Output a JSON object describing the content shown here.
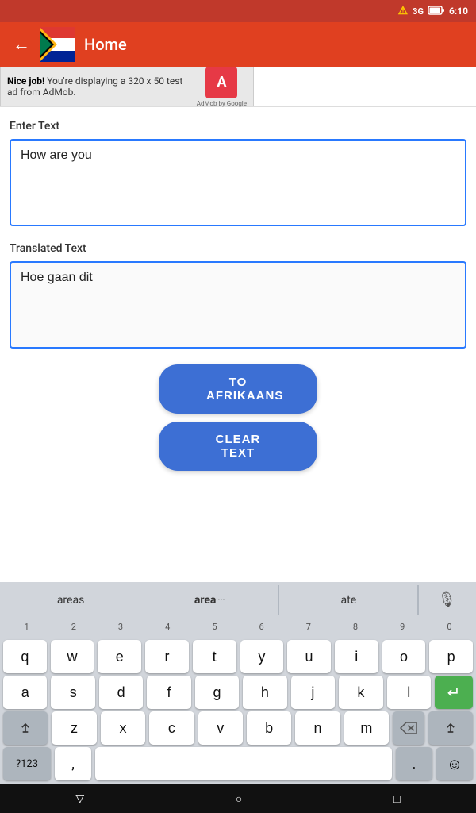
{
  "statusBar": {
    "signal": "3G",
    "battery": "🔋",
    "time": "6:10",
    "alert": "⚠"
  },
  "appBar": {
    "title": "Home",
    "backLabel": "←"
  },
  "ad": {
    "text_bold": "Nice job!",
    "text_regular": " You're displaying a 320 x 50 test ad from AdMob.",
    "logo_letter": "A",
    "sub_text": "AdMob by Google"
  },
  "inputSection": {
    "label": "Enter Text",
    "placeholder": "How are you",
    "value": "How are you"
  },
  "translatedSection": {
    "label": "Translated Text",
    "value": "Hoe gaan dit"
  },
  "buttons": {
    "translate": "TO AFRIKAANS",
    "clear": "CLEAR TEXT"
  },
  "keyboard": {
    "autocomplete": [
      "areas",
      "area",
      "ate"
    ],
    "rows": [
      [
        "q",
        "w",
        "e",
        "r",
        "t",
        "y",
        "u",
        "i",
        "o",
        "p"
      ],
      [
        "a",
        "s",
        "d",
        "f",
        "g",
        "h",
        "j",
        "k",
        "l"
      ],
      [
        "z",
        "x",
        "c",
        "v",
        "b",
        "n",
        "m"
      ]
    ],
    "numbers": [
      "1",
      "2",
      "3",
      "4",
      "5",
      "6",
      "7",
      "8",
      "9",
      "0"
    ],
    "sym_label": "?123",
    "comma": ",",
    "period": "."
  },
  "sysNav": {
    "back": "▽",
    "home": "○",
    "recent": "□"
  }
}
